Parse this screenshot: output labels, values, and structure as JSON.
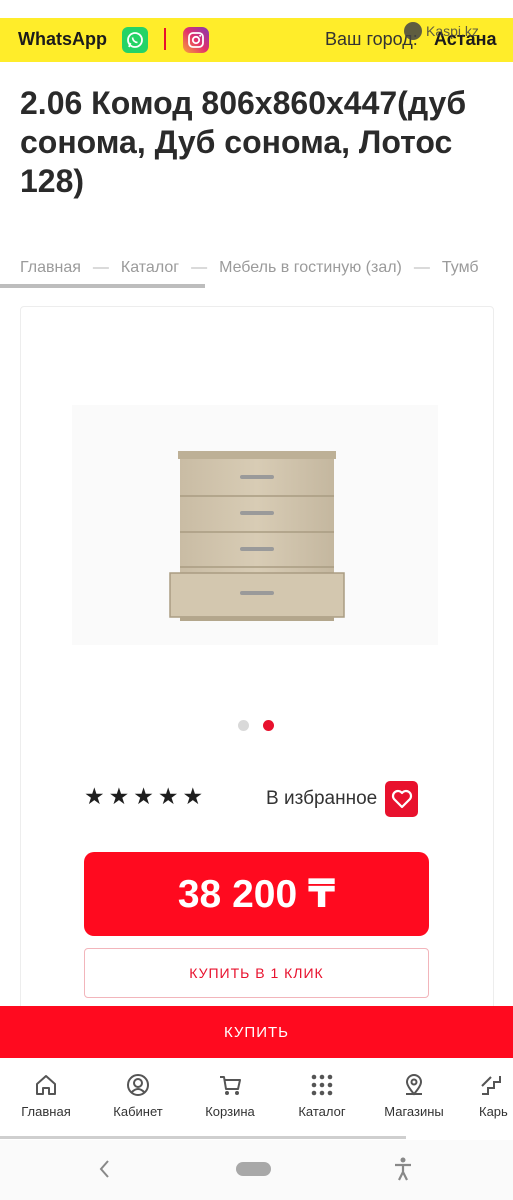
{
  "topbar": {
    "whatsapp_label": "WhatsApp",
    "whatsapp_icon": "whatsapp-icon",
    "instagram_icon": "instagram-icon",
    "city_label": "Ваш город:",
    "city_value": "Астана",
    "watermark": "Kaspi.kz",
    "bg_color": "#ffed2a"
  },
  "product": {
    "title": "2.06 Комод 806x860x447(дуб сонома, Дуб сонома, Лотос 128)",
    "rating_stars": "★★★★★",
    "favorite_label": "В избранное",
    "price": "38 200 ₸",
    "one_click_label": "КУПИТЬ В 1 КЛИК",
    "buy_label": "КУПИТЬ",
    "image_count": 2,
    "active_image": 2
  },
  "breadcrumb": {
    "items": [
      "Главная",
      "Каталог",
      "Мебель в гостиную (зал)",
      "Тумб"
    ]
  },
  "bottom_nav": {
    "items": [
      {
        "label": "Главная",
        "icon": "home-icon"
      },
      {
        "label": "Кабинет",
        "icon": "user-icon"
      },
      {
        "label": "Корзина",
        "icon": "cart-icon"
      },
      {
        "label": "Каталог",
        "icon": "grid-icon"
      },
      {
        "label": "Магазины",
        "icon": "location-icon"
      },
      {
        "label": "Карь",
        "icon": "stairs-icon"
      }
    ]
  },
  "colors": {
    "accent": "#ff0a1f",
    "accent_dark": "#e8112d"
  }
}
